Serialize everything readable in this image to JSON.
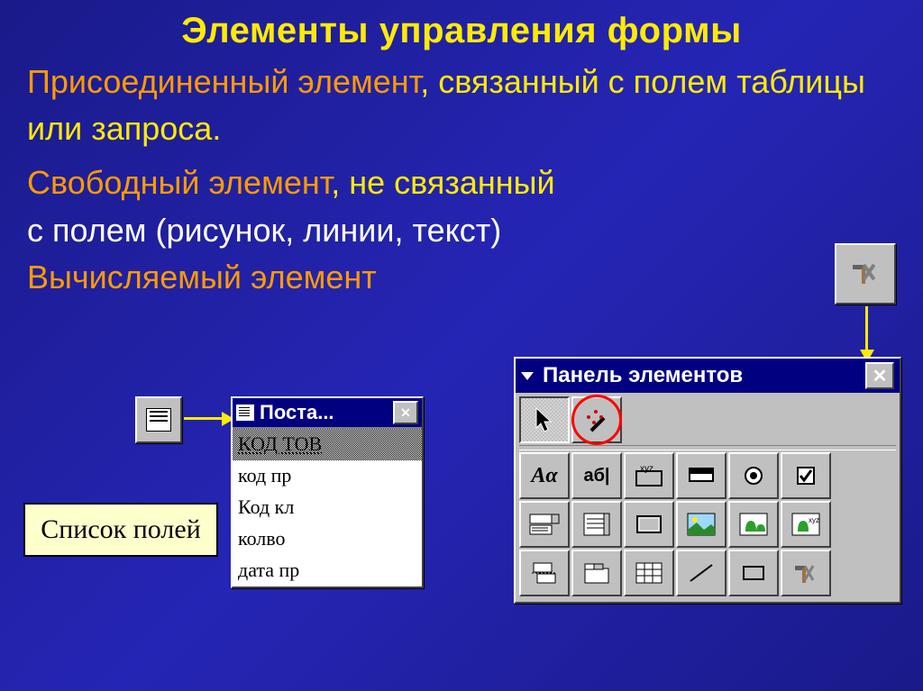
{
  "title": "Элементы управления формы",
  "p1": {
    "a": "Присоединенный элемент",
    "b": ", связанный с полем таблицы или запроса."
  },
  "p2": {
    "a": "Свободный элемент",
    "b": ", не связанный"
  },
  "p3": "с полем  (рисунок, линии, текст)",
  "p4": "Вычисляемый элемент",
  "fields_label": "Список полей",
  "list_window": {
    "title": "Поста...",
    "items": [
      "КОД ТОВ",
      "код пр",
      "Код кл",
      "колво",
      "дата пр"
    ]
  },
  "toolbox": {
    "title": "Панель элементов",
    "row1": [
      "pointer",
      "wizard"
    ],
    "row2_labels": [
      "Aa",
      "аб|",
      "xyz",
      "btn",
      "radio",
      "check"
    ],
    "row3_labels": [
      "combo",
      "list",
      "frame",
      "image",
      "unbound",
      "bound"
    ],
    "row4_labels": [
      "page",
      "tab",
      "sub",
      "line",
      "rect",
      "more"
    ]
  }
}
